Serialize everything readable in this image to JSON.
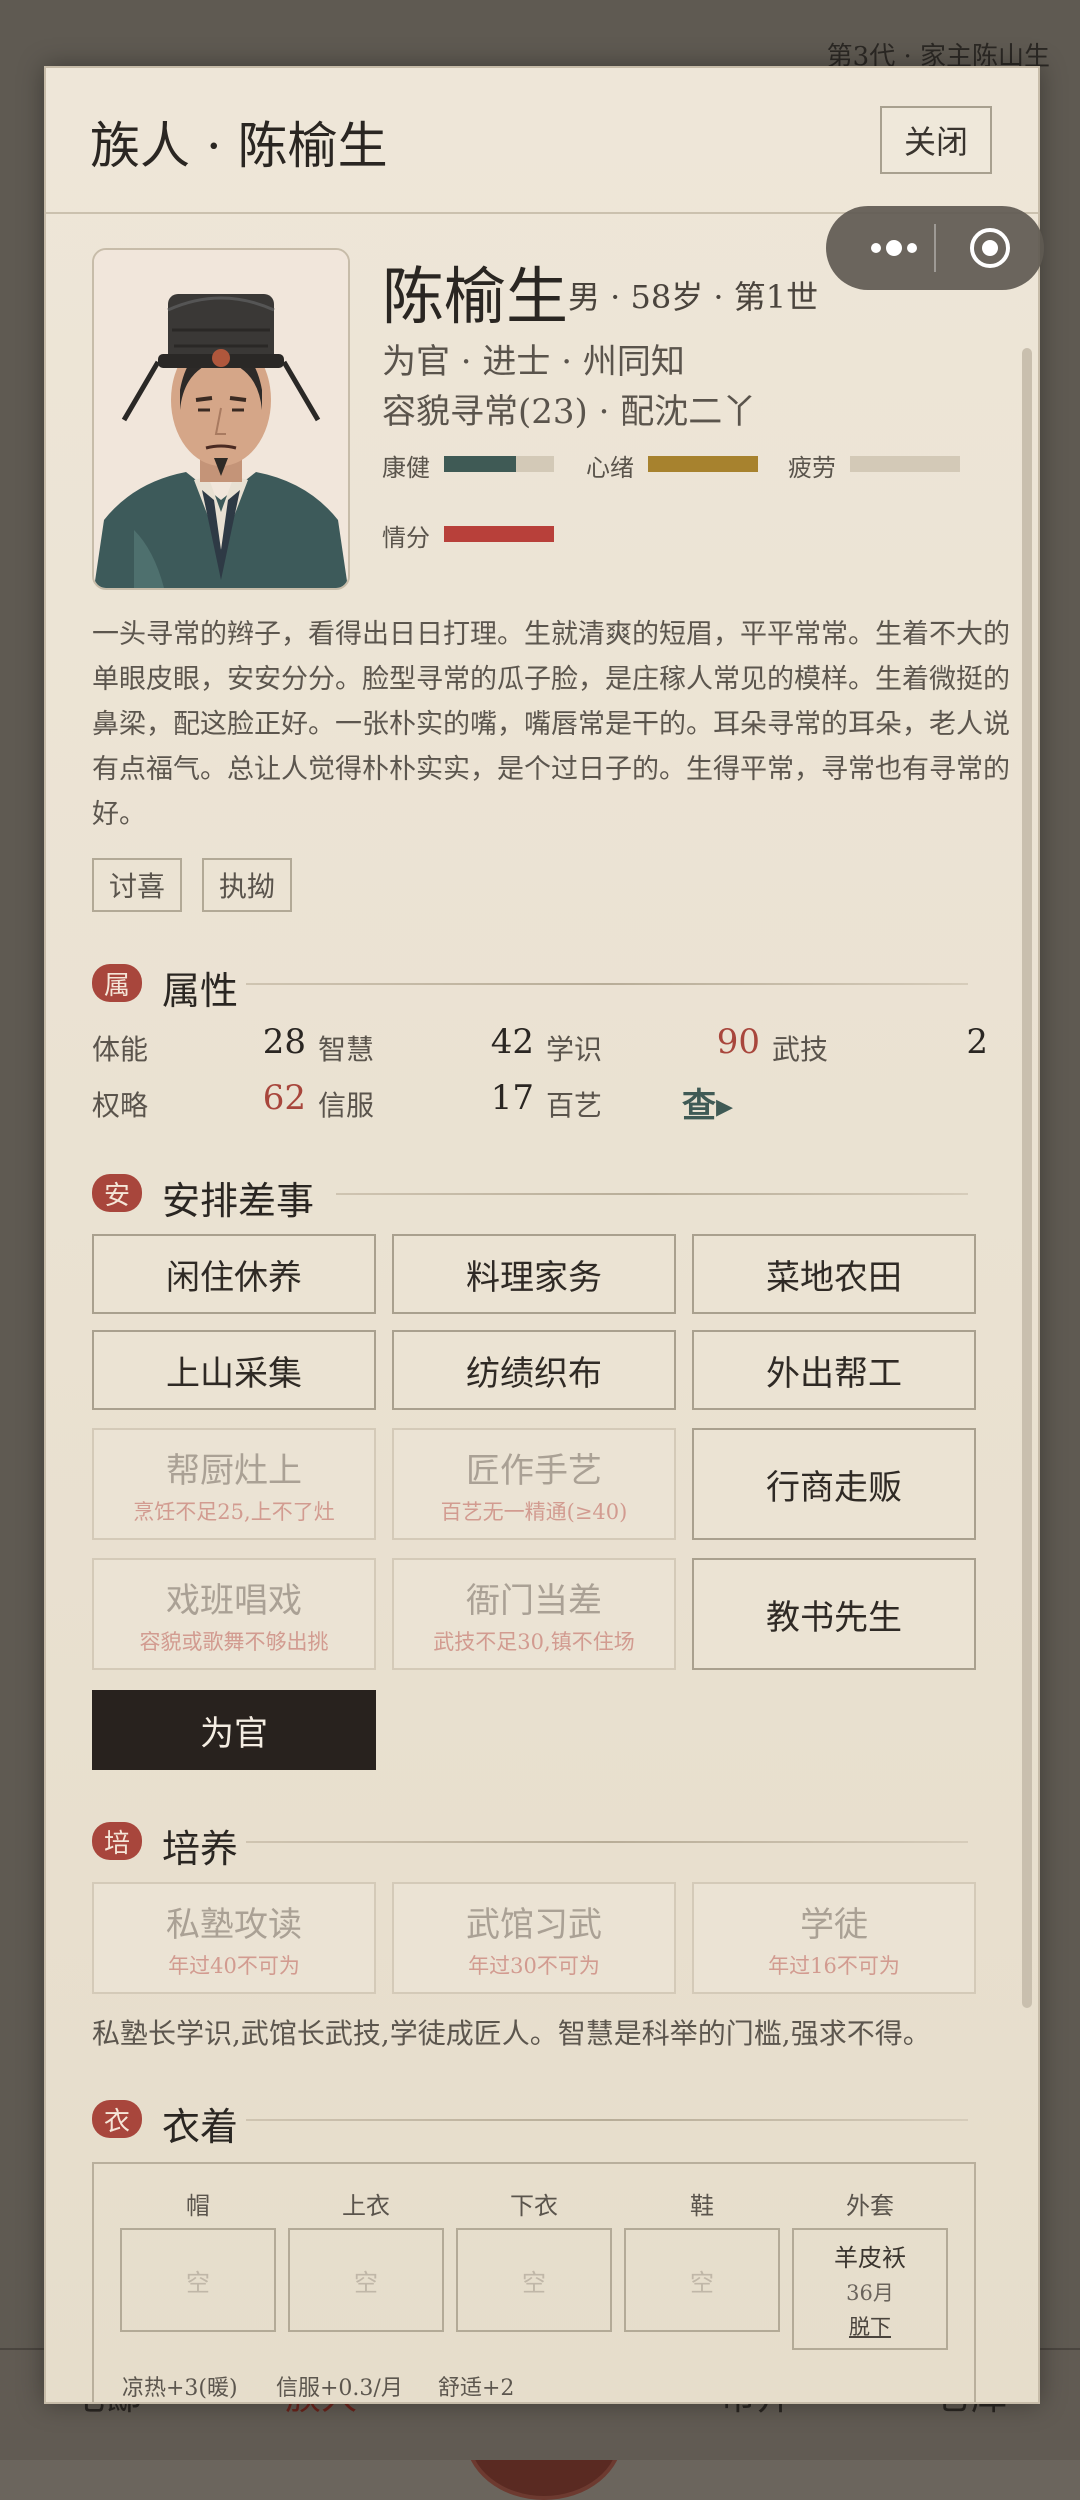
{
  "background": {
    "top_right": "第3代 · 家主陈山生",
    "nav": [
      "宅邸",
      "族人",
      "市井",
      "仓库"
    ]
  },
  "dialog": {
    "title": "族人 · 陈榆生",
    "close_label": "关闭"
  },
  "profile": {
    "name": "陈榆生",
    "meta": "男 · 58岁 · 第1世",
    "role": "为官 · 进士 · 州同知",
    "looks": "容貌寻常(23) · 配沈二丫",
    "bars": [
      {
        "label": "康健",
        "level": 0.65,
        "color": "#3f5a55"
      },
      {
        "label": "心绪",
        "level": 1.0,
        "color": "#a7822e"
      },
      {
        "label": "疲劳",
        "level": 0.0,
        "color": "#d3c9b7"
      },
      {
        "label": "情分",
        "level": 1.0,
        "color": "#b8403a"
      }
    ]
  },
  "description": "一头寻常的辫子，看得出日日打理。生就清爽的短眉，平平常常。生着不大的单眼皮眼，安安分分。脸型寻常的瓜子脸，是庄稼人常见的模样。生着微挺的鼻梁，配这脸正好。一张朴实的嘴，嘴唇常是干的。耳朵寻常的耳朵，老人说有点福气。总让人觉得朴朴实实，是个过日子的。生得平常，寻常也有寻常的好。",
  "tags": [
    "讨喜",
    "执拗"
  ],
  "attributes": {
    "badge": "属",
    "title": "属性",
    "items": [
      {
        "label": "体能",
        "value": "28",
        "color": "#2a2622"
      },
      {
        "label": "智慧",
        "value": "42",
        "color": "#2a2622"
      },
      {
        "label": "学识",
        "value": "90",
        "color": "#a8463c"
      },
      {
        "label": "武技",
        "value": "2",
        "color": "#2a2622"
      },
      {
        "label": "权略",
        "value": "62",
        "color": "#a8463c"
      },
      {
        "label": "信服",
        "value": "17",
        "color": "#2a2622"
      },
      {
        "label": "百艺",
        "value": "查▸",
        "color": "#3f5a55"
      }
    ]
  },
  "jobs": {
    "badge": "安",
    "title": "安排差事",
    "items": [
      {
        "label": "闲住休养",
        "sub": ""
      },
      {
        "label": "料理家务",
        "sub": ""
      },
      {
        "label": "菜地农田",
        "sub": ""
      },
      {
        "label": "上山采集",
        "sub": ""
      },
      {
        "label": "纺绩织布",
        "sub": ""
      },
      {
        "label": "外出帮工",
        "sub": ""
      },
      {
        "label": "帮厨灶上",
        "sub": "烹饪不足25,上不了灶"
      },
      {
        "label": "匠作手艺",
        "sub": "百艺无一精通(≥40)"
      },
      {
        "label": "行商走贩",
        "sub": ""
      },
      {
        "label": "戏班唱戏",
        "sub": "容貌或歌舞不够出挑"
      },
      {
        "label": "衙门当差",
        "sub": "武技不足30,镇不住场"
      },
      {
        "label": "教书先生",
        "sub": ""
      },
      {
        "label": "为官",
        "sub": ""
      }
    ]
  },
  "training": {
    "badge": "培",
    "title": "培养",
    "items": [
      {
        "label": "私塾攻读",
        "sub": "年过40不可为"
      },
      {
        "label": "武馆习武",
        "sub": "年过30不可为"
      },
      {
        "label": "学徒",
        "sub": "年过16不可为"
      }
    ],
    "note": "私塾长学识,武馆长武技,学徒成匠人。智慧是科举的门槛,强求不得。"
  },
  "clothing": {
    "badge": "衣",
    "title": "衣着",
    "slots": [
      {
        "title": "帽",
        "value": "空"
      },
      {
        "title": "上衣",
        "value": "空"
      },
      {
        "title": "下衣",
        "value": "空"
      },
      {
        "title": "鞋",
        "value": "空"
      },
      {
        "title": "外套",
        "value": "羊皮袄",
        "detail": "36月",
        "action": "脱下"
      }
    ],
    "effects": [
      "凉热+3(暖)",
      "信服+0.3/月",
      "舒适+2"
    ]
  }
}
